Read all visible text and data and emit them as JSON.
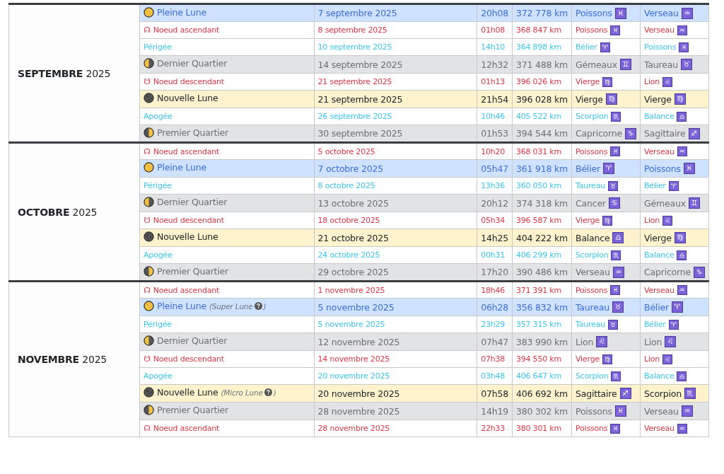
{
  "months": [
    {
      "label": "**SEPTEMBRE** 2025",
      "events": [
        {
          "kind": "full",
          "name": "Pleine Lune",
          "date": "7 septembre 2025",
          "time": "20h08",
          "distance": "372 778 km",
          "column_5": {
            "name": "Poissons",
            "symbol": "♓"
          },
          "column_6": {
            "name": "Verseau",
            "symbol": "♒"
          }
        },
        {
          "kind": "node_asc",
          "symbol": "☊",
          "name": "Noeud ascendant",
          "date": "8 septembre 2025",
          "time": "01h08",
          "distance": "368 847 km",
          "column_5": {
            "name": "Poissons",
            "symbol": "♓"
          },
          "column_6": {
            "name": "Verseau",
            "symbol": "♒"
          }
        },
        {
          "kind": "perigee",
          "name": "Périgée",
          "date": "10 septembre 2025",
          "time": "14h10",
          "distance": "364 898 km",
          "column_5": {
            "name": "Bélier",
            "symbol": "♈"
          },
          "column_6": {
            "name": "Poissons",
            "symbol": "♓"
          }
        },
        {
          "kind": "last_quarter",
          "name": "Dernier Quartier",
          "date": "14 septembre 2025",
          "time": "12h32",
          "distance": "371 488 km",
          "column_5": {
            "name": "Gémeaux",
            "symbol": "♊"
          },
          "column_6": {
            "name": "Taureau",
            "symbol": "♉"
          }
        },
        {
          "kind": "node_desc",
          "symbol": "☋",
          "name": "Noeud descendant",
          "date": "21 septembre 2025",
          "time": "01h13",
          "distance": "396 026 km",
          "column_5": {
            "name": "Vierge",
            "symbol": "♍"
          },
          "column_6": {
            "name": "Lion",
            "symbol": "♌"
          }
        },
        {
          "kind": "new",
          "name": "Nouvelle Lune",
          "date": "21 septembre 2025",
          "time": "21h54",
          "distance": "396 028 km",
          "column_5": {
            "name": "Vierge",
            "symbol": "♍"
          },
          "column_6": {
            "name": "Vierge",
            "symbol": "♍"
          }
        },
        {
          "kind": "apogee",
          "name": "Apogée",
          "date": "26 septembre 2025",
          "time": "10h46",
          "distance": "405 522 km",
          "column_5": {
            "name": "Scorpion",
            "symbol": "♏"
          },
          "column_6": {
            "name": "Balance",
            "symbol": "♎"
          }
        },
        {
          "kind": "first_quarter",
          "name": "Premier Quartier",
          "date": "30 septembre 2025",
          "time": "01h53",
          "distance": "394 544 km",
          "column_5": {
            "name": "Capricorne",
            "symbol": "♑"
          },
          "column_6": {
            "name": "Sagittaire",
            "symbol": "♐"
          }
        }
      ]
    },
    {
      "label": "**OCTOBRE** 2025",
      "events": [
        {
          "kind": "node_asc",
          "symbol": "☊",
          "name": "Noeud ascendant",
          "date": "5 octobre 2025",
          "time": "10h20",
          "distance": "368 031 km",
          "column_5": {
            "name": "Poissons",
            "symbol": "♓"
          },
          "column_6": {
            "name": "Verseau",
            "symbol": "♒"
          }
        },
        {
          "kind": "full",
          "name": "Pleine Lune",
          "date": "7 octobre 2025",
          "time": "05h47",
          "distance": "361 918 km",
          "column_5": {
            "name": "Bélier",
            "symbol": "♈"
          },
          "column_6": {
            "name": "Poissons",
            "symbol": "♓"
          }
        },
        {
          "kind": "perigee",
          "name": "Périgée",
          "date": "8 octobre 2025",
          "time": "13h36",
          "distance": "360 050 km",
          "column_5": {
            "name": "Taureau",
            "symbol": "♉"
          },
          "column_6": {
            "name": "Bélier",
            "symbol": "♈"
          }
        },
        {
          "kind": "last_quarter",
          "name": "Dernier Quartier",
          "date": "13 octobre 2025",
          "time": "20h12",
          "distance": "374 318 km",
          "column_5": {
            "name": "Cancer",
            "symbol": "♋"
          },
          "column_6": {
            "name": "Gémeaux",
            "symbol": "♊"
          }
        },
        {
          "kind": "node_desc",
          "symbol": "☋",
          "name": "Noeud descendant",
          "date": "18 octobre 2025",
          "time": "05h34",
          "distance": "396 587 km",
          "column_5": {
            "name": "Vierge",
            "symbol": "♍"
          },
          "column_6": {
            "name": "Lion",
            "symbol": "♌"
          }
        },
        {
          "kind": "new",
          "name": "Nouvelle Lune",
          "date": "21 octobre 2025",
          "time": "14h25",
          "distance": "404 222 km",
          "column_5": {
            "name": "Balance",
            "symbol": "♎"
          },
          "column_6": {
            "name": "Vierge",
            "symbol": "♍"
          }
        },
        {
          "kind": "apogee",
          "name": "Apogée",
          "date": "24 octobre 2025",
          "time": "00h31",
          "distance": "406 299 km",
          "column_5": {
            "name": "Scorpion",
            "symbol": "♏"
          },
          "column_6": {
            "name": "Balance",
            "symbol": "♎"
          }
        },
        {
          "kind": "first_quarter",
          "name": "Premier Quartier",
          "date": "29 octobre 2025",
          "time": "17h20",
          "distance": "390 486 km",
          "column_5": {
            "name": "Verseau",
            "symbol": "♒"
          },
          "column_6": {
            "name": "Capricorne",
            "symbol": "♑"
          }
        }
      ]
    },
    {
      "label": "**NOVEMBRE** 2025",
      "events": [
        {
          "kind": "node_asc",
          "symbol": "☊",
          "name": "Noeud ascendant",
          "date": "1 novembre 2025",
          "time": "18h46",
          "distance": "371 391 km",
          "column_5": {
            "name": "Poissons",
            "symbol": "♓"
          },
          "column_6": {
            "name": "Verseau",
            "symbol": "♒"
          }
        },
        {
          "kind": "full",
          "name": "Pleine Lune",
          "note": [
            "(Super Lune",
            ")"
          ],
          "date": "5 novembre 2025",
          "time": "06h28",
          "distance": "356 832 km",
          "column_5": {
            "name": "Taureau",
            "symbol": "♉"
          },
          "column_6": {
            "name": "Bélier",
            "symbol": "♈"
          }
        },
        {
          "kind": "perigee",
          "name": "Périgée",
          "date": "5 novembre 2025",
          "time": "23h29",
          "distance": "357 315 km",
          "column_5": {
            "name": "Taureau",
            "symbol": "♉"
          },
          "column_6": {
            "name": "Bélier",
            "symbol": "♈"
          }
        },
        {
          "kind": "last_quarter",
          "name": "Dernier Quartier",
          "date": "12 novembre 2025",
          "time": "07h47",
          "distance": "383 990 km",
          "column_5": {
            "name": "Lion",
            "symbol": "♌"
          },
          "column_6": {
            "name": "Lion",
            "symbol": "♌"
          }
        },
        {
          "kind": "node_desc",
          "symbol": "☋",
          "name": "Noeud descendant",
          "date": "14 novembre 2025",
          "time": "07h38",
          "distance": "394 550 km",
          "column_5": {
            "name": "Vierge",
            "symbol": "♍"
          },
          "column_6": {
            "name": "Lion",
            "symbol": "♌"
          }
        },
        {
          "kind": "apogee",
          "name": "Apogée",
          "date": "20 novembre 2025",
          "time": "03h48",
          "distance": "406 647 km",
          "column_5": {
            "name": "Scorpion",
            "symbol": "♏"
          },
          "column_6": {
            "name": "Balance",
            "symbol": "♎"
          }
        },
        {
          "kind": "new",
          "name": "Nouvelle Lune",
          "note": [
            "(Micro Lune",
            ")"
          ],
          "date": "20 novembre 2025",
          "time": "07h58",
          "distance": "406 692 km",
          "column_5": {
            "name": "Sagittaire",
            "symbol": "♐"
          },
          "column_6": {
            "name": "Scorpion",
            "symbol": "♏"
          }
        },
        {
          "kind": "first_quarter",
          "name": "Premier Quartier",
          "date": "28 novembre 2025",
          "time": "14h19",
          "distance": "380 302 km",
          "column_5": {
            "name": "Poissons",
            "symbol": "♓"
          },
          "column_6": {
            "name": "Verseau",
            "symbol": "♒"
          }
        },
        {
          "kind": "node_asc",
          "symbol": "☊",
          "name": "Noeud ascendant",
          "date": "28 novembre 2025",
          "time": "22h33",
          "distance": "380 301 km",
          "column_5": {
            "name": "Poissons",
            "symbol": "♓"
          },
          "column_6": {
            "name": "Verseau",
            "symbol": "♒"
          }
        }
      ]
    }
  ]
}
